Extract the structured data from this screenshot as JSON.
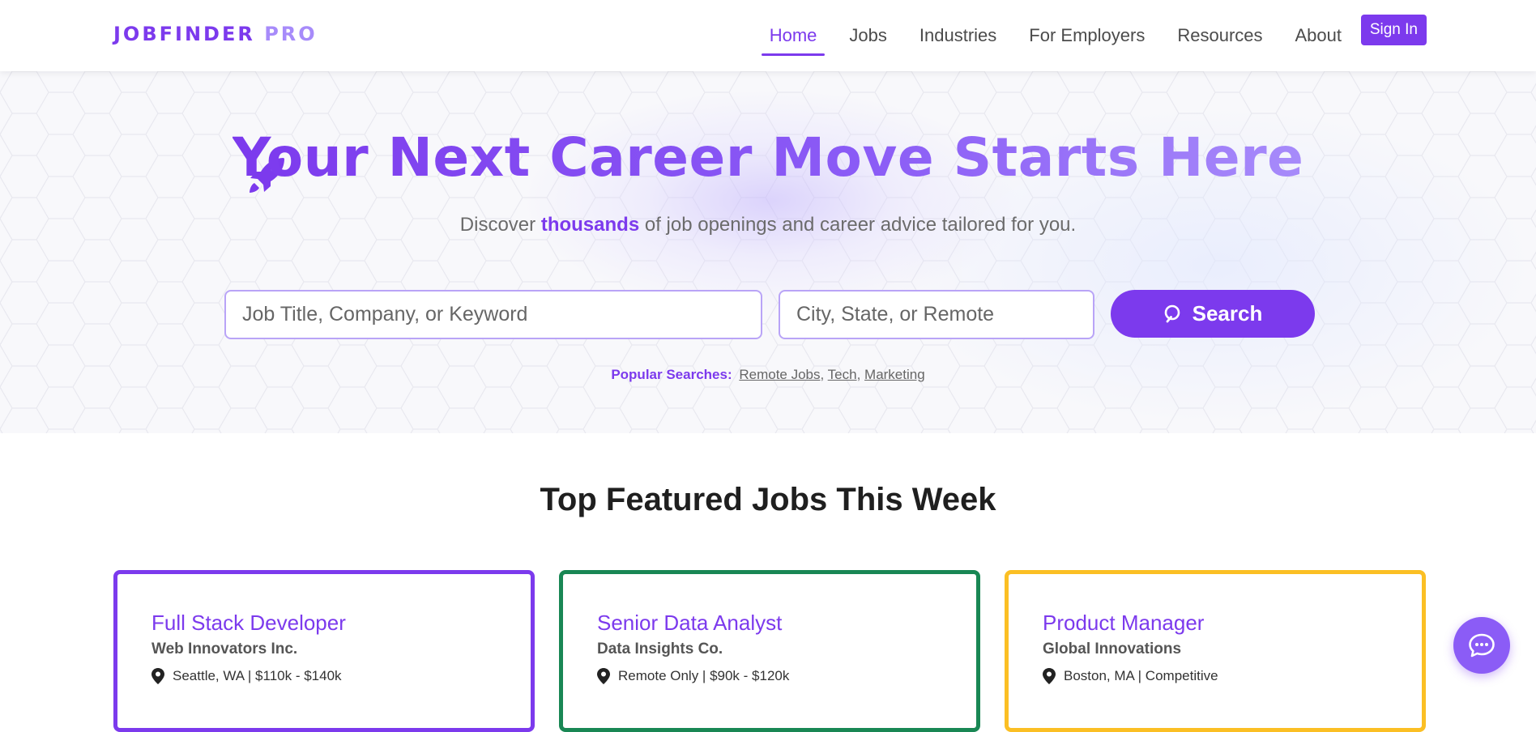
{
  "header": {
    "logo_main": "JOBFINDER",
    "logo_accent": "PRO",
    "nav": [
      "Home",
      "Jobs",
      "Industries",
      "For Employers",
      "Resources",
      "About"
    ],
    "active_nav": "Home",
    "signin_label": "Sign In"
  },
  "hero": {
    "title": "Your Next Career Move Starts Here",
    "subtitle_before": "Discover ",
    "subtitle_emphasis": "thousands",
    "subtitle_after": " of job openings and career advice tailored for you.",
    "keyword_placeholder": "Job Title, Company, or Keyword",
    "location_placeholder": "City, State, or Remote",
    "search_label": "Search",
    "popular_label": "Popular Searches:",
    "popular": [
      "Remote Jobs",
      "Tech",
      "Marketing"
    ],
    "icon": "rocket-icon"
  },
  "featured": {
    "title": "Top Featured Jobs This Week",
    "jobs": [
      {
        "title": "Full Stack Developer",
        "company": "Web Innovators Inc.",
        "details": "Seattle, WA | $110k - $140k",
        "accent": "#7c3aed"
      },
      {
        "title": "Senior Data Analyst",
        "company": "Data Insights Co.",
        "details": "Remote Only | $90k - $120k",
        "accent": "#198754"
      },
      {
        "title": "Product Manager",
        "company": "Global Innovations",
        "details": "Boston, MA | Competitive",
        "accent": "#fbbf24"
      }
    ]
  },
  "colors": {
    "brand": "#7c3aed",
    "brand_light": "#a78bfa"
  },
  "chat_icon": "chat-bubble-icon"
}
